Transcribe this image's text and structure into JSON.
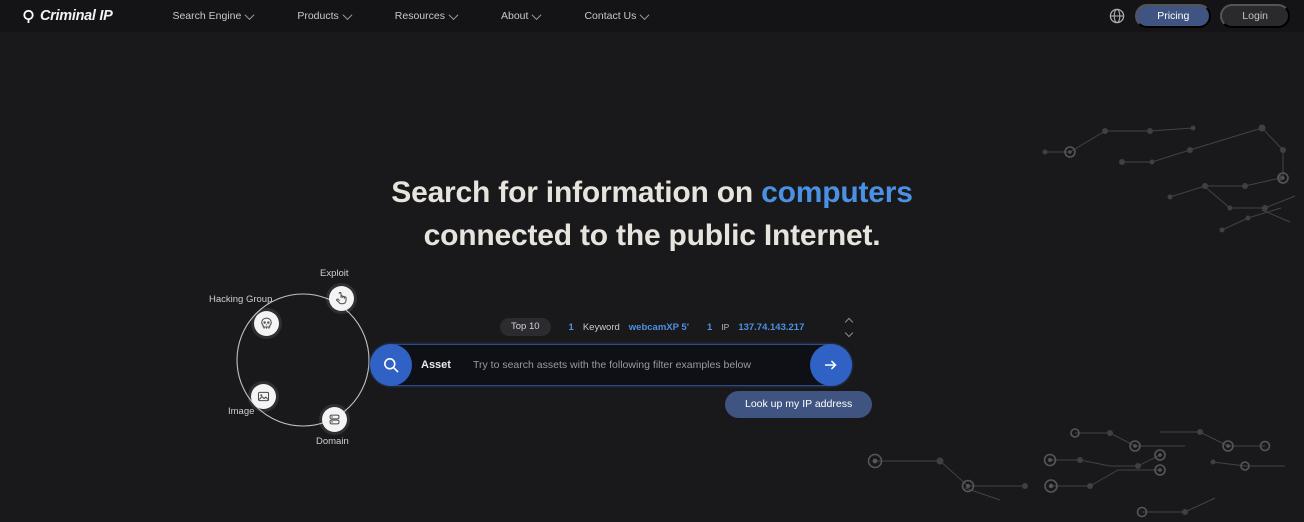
{
  "brand": {
    "name": "Criminal IP",
    "mark_icon": "magnifier-logo-icon"
  },
  "nav": {
    "items": [
      {
        "label": "Search Engine",
        "icon": "chevron-down-icon"
      },
      {
        "label": "Products",
        "icon": "chevron-down-icon"
      },
      {
        "label": "Resources",
        "icon": "chevron-down-icon"
      },
      {
        "label": "About",
        "icon": "chevron-down-icon"
      },
      {
        "label": "Contact Us",
        "icon": "chevron-down-icon"
      }
    ],
    "language_icon": "globe-icon",
    "pricing_label": "Pricing",
    "login_label": "Login"
  },
  "hero": {
    "headline_part1": "Search for information on ",
    "headline_accent": "computers",
    "headline_part2": "connected to the public Internet.",
    "accent_color": "#4b90e2"
  },
  "graph": {
    "nodes": [
      {
        "label": "Exploit",
        "icon": "cursor-click-icon"
      },
      {
        "label": "Hacking Group",
        "icon": "skull-icon"
      },
      {
        "label": "Image",
        "icon": "image-icon"
      },
      {
        "label": "Domain",
        "icon": "database-icon"
      }
    ]
  },
  "filters": {
    "top_chip": "Top 10",
    "examples": [
      {
        "rank": "1",
        "field": "Keyword",
        "value": "webcamXP 5'"
      },
      {
        "rank": "1",
        "field": "IP",
        "value": "137.74.143.217"
      }
    ],
    "scroll_up_icon": "chevron-up-icon",
    "scroll_down_icon": "chevron-down-icon"
  },
  "search": {
    "icon": "search-icon",
    "type_label": "Asset",
    "placeholder": "Try to search assets with the following filter examples below",
    "value": "",
    "submit_icon": "arrow-right-icon",
    "accent_color": "#2f62c4"
  },
  "lookup": {
    "label": "Look up my IP address"
  }
}
